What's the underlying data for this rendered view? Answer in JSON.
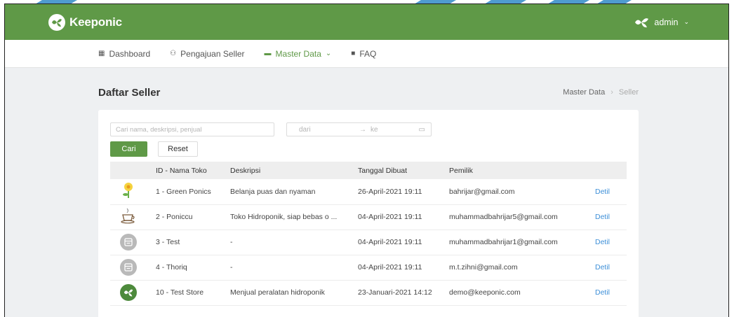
{
  "header": {
    "brand": "Keeponic",
    "user": "admin"
  },
  "nav": [
    {
      "label": "Dashboard",
      "icon": "grid-icon",
      "active": false
    },
    {
      "label": "Pengajuan Seller",
      "icon": "users-icon",
      "active": false
    },
    {
      "label": "Master Data",
      "icon": "database-icon",
      "active": true,
      "dropdown": true
    },
    {
      "label": "FAQ",
      "icon": "chat-icon",
      "active": false
    }
  ],
  "page": {
    "title": "Daftar Seller",
    "breadcrumb": [
      "Master Data",
      "Seller"
    ]
  },
  "filters": {
    "search_placeholder": "Cari nama, deskripsi, penjual",
    "date_from": "dari",
    "date_arrow": "→",
    "date_to": "ke",
    "search_button": "Cari",
    "reset_button": "Reset"
  },
  "table": {
    "columns": [
      "ID - Nama Toko",
      "Deskripsi",
      "Tanggal Dibuat",
      "Pemilik"
    ],
    "rows": [
      {
        "image": "flower-image",
        "id_name": "1 - Green Ponics",
        "desc": "Belanja puas dan nyaman",
        "date": "26-April-2021 19:11",
        "owner": "bahrijar@gmail.com",
        "action": "Detil"
      },
      {
        "image": "coffee-image",
        "id_name": "2 - Poniccu",
        "desc": "Toko Hidroponik, siap bebas o ...",
        "date": "04-April-2021 19:11",
        "owner": "muhammadbahrijar5@gmail.com",
        "action": "Detil"
      },
      {
        "image": "store-placeholder",
        "id_name": "3 - Test",
        "desc": "-",
        "date": "04-April-2021 19:11",
        "owner": "muhammadbahrijar1@gmail.com",
        "action": "Detil"
      },
      {
        "image": "store-placeholder",
        "id_name": "4 - Thoriq",
        "desc": "-",
        "date": "04-April-2021 19:11",
        "owner": "m.t.zihni@gmail.com",
        "action": "Detil"
      },
      {
        "image": "keeponic-logo",
        "id_name": "10 - Test Store",
        "desc": "Menjual peralatan hidroponik",
        "date": "23-Januari-2021 14:12",
        "owner": "demo@keeponic.com",
        "action": "Detil"
      }
    ]
  },
  "colors": {
    "primary": "#5f9947",
    "link": "#3d8fd8"
  }
}
